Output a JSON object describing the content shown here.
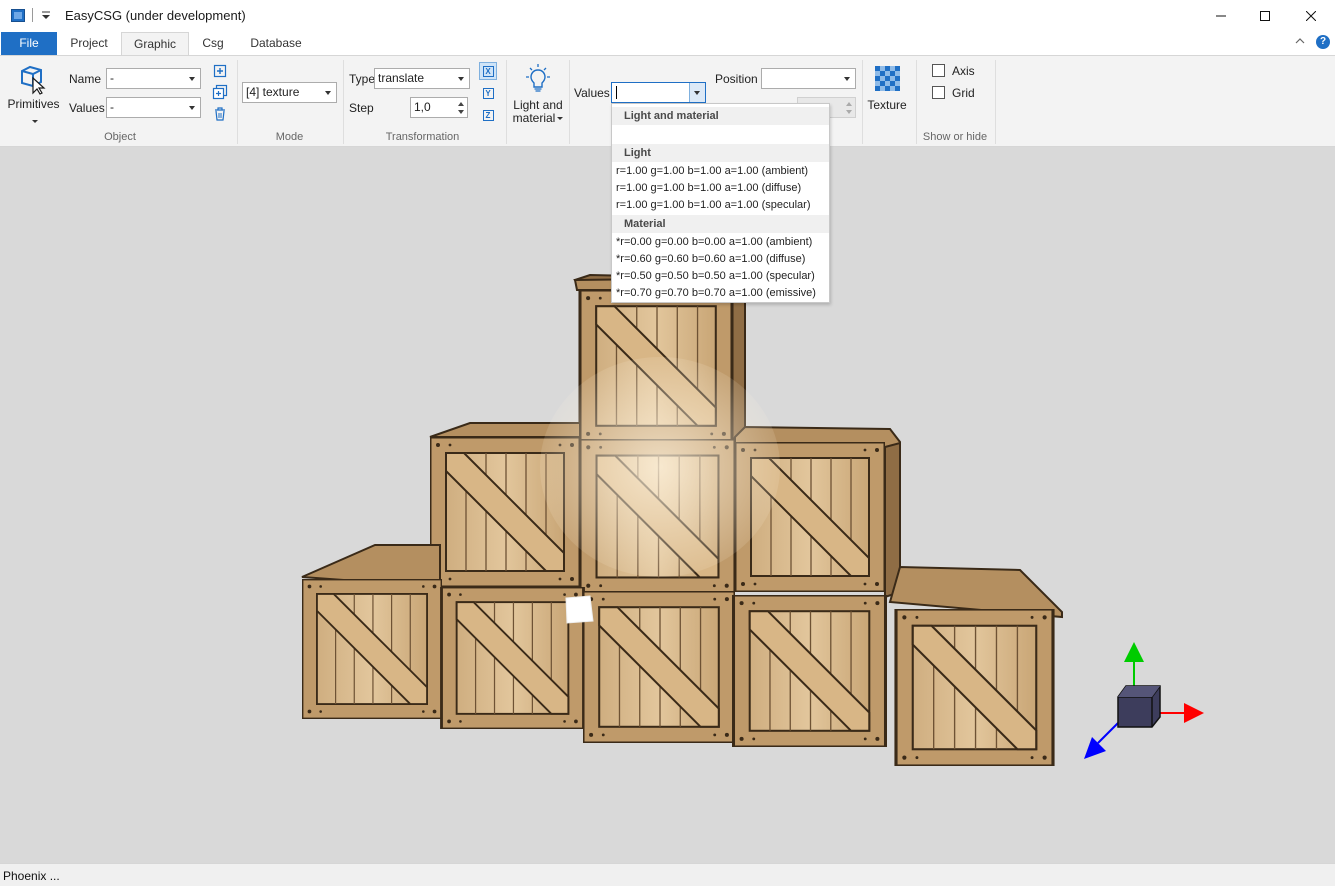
{
  "window": {
    "title": "EasyCSG (under development)"
  },
  "tabs": [
    {
      "label": "File"
    },
    {
      "label": "Project"
    },
    {
      "label": "Graphic"
    },
    {
      "label": "Csg"
    },
    {
      "label": "Database"
    }
  ],
  "ribbon": {
    "object": {
      "primitives_label": "Primitives",
      "name_label": "Name",
      "name_value": "-",
      "values_label": "Values",
      "values_value": "-",
      "group_label": "Object"
    },
    "mode": {
      "value": "[4] texture",
      "group_label": "Mode"
    },
    "transformation": {
      "type_label": "Type",
      "type_value": "translate",
      "step_label": "Step",
      "step_value": "1,0",
      "axes": [
        "X",
        "Y",
        "Z"
      ],
      "group_label": "Transformation"
    },
    "light": {
      "button_label_1": "Light and",
      "button_label_2": "material",
      "values_label": "Values",
      "values_value": "",
      "position_label": "Position",
      "position_value": ""
    },
    "texture": {
      "button_label": "Texture"
    },
    "show_hide": {
      "axis_label": "Axis",
      "grid_label": "Grid",
      "group_label": "Show or hide"
    }
  },
  "dropdown": {
    "sections": [
      {
        "header": "Light and material",
        "items": []
      },
      {
        "header": "Light",
        "items": [
          "r=1.00 g=1.00 b=1.00 a=1.00 (ambient)",
          "r=1.00 g=1.00 b=1.00 a=1.00 (diffuse)",
          "r=1.00 g=1.00 b=1.00 a=1.00 (specular)"
        ]
      },
      {
        "header": "Material",
        "items": [
          "*r=0.00 g=0.00 b=0.00 a=1.00 (ambient)",
          "*r=0.60 g=0.60 b=0.60 a=1.00 (diffuse)",
          "*r=0.50 g=0.50 b=0.50 a=1.00 (specular)",
          "*r=0.70 g=0.70 b=0.70 a=1.00 (emissive)"
        ]
      }
    ]
  },
  "status": {
    "text": "Phoenix ..."
  },
  "colors": {
    "accent": "#1f6fc5",
    "viewport_bg": "#d9d9d9",
    "crate_light": "#d9b98c",
    "crate_dark": "#8a6a44",
    "axis_x": "#ff0000",
    "axis_y": "#00cc00",
    "axis_z": "#0000ff",
    "gizmo_cube": "#3d3d5c"
  }
}
